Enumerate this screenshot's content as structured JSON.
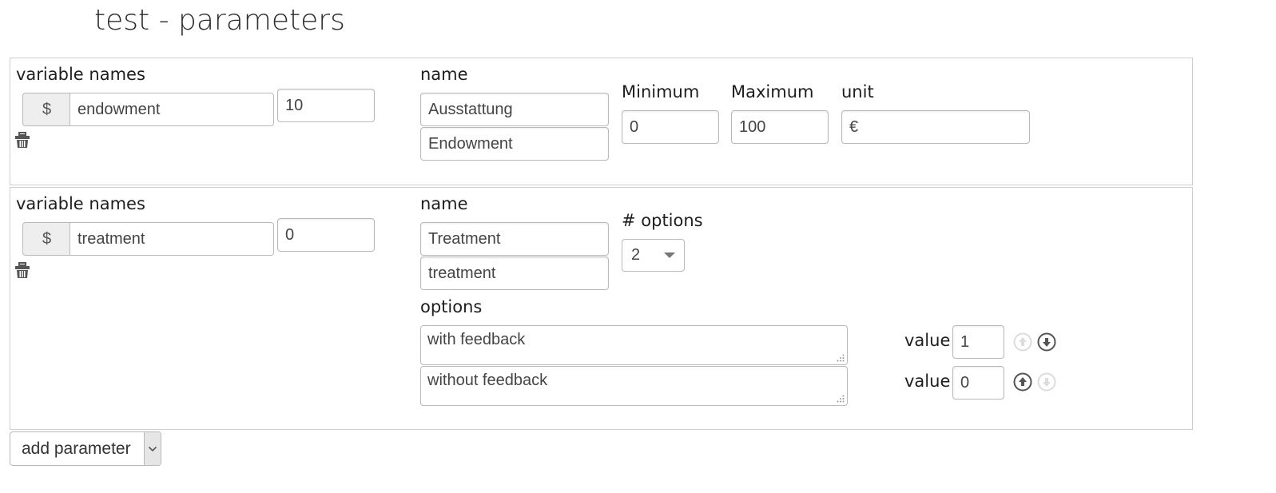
{
  "page": {
    "title": "test - parameters"
  },
  "parameters": [
    {
      "variable_names_label": "variable names",
      "prefix": "$",
      "variable": "endowment",
      "default_value": "10",
      "name_label": "name",
      "name_primary": "Ausstattung",
      "name_secondary": "Endowment",
      "minimum_label": "Minimum",
      "minimum": "0",
      "maximum_label": "Maximum",
      "maximum": "100",
      "unit_label": "unit",
      "unit": "€",
      "delete_icon": "trash-basket-icon"
    },
    {
      "variable_names_label": "variable names",
      "prefix": "$",
      "variable": "treatment",
      "default_value": "0",
      "name_label": "name",
      "name_primary": "Treatment",
      "name_secondary": "treatment",
      "num_options_label": "# options",
      "num_options": "2",
      "options_label": "options",
      "options": [
        {
          "text": "with feedback",
          "value_label": "value",
          "value": "1",
          "up_enabled": false,
          "down_enabled": true
        },
        {
          "text": "without feedback",
          "value_label": "value",
          "value": "0",
          "up_enabled": true,
          "down_enabled": false
        }
      ],
      "delete_icon": "trash-basket-icon"
    }
  ],
  "footer": {
    "add_parameter_label": "add parameter"
  },
  "colors": {
    "border": "#cfcfcf",
    "addon_bg": "#eeeeee",
    "icon": "#555555",
    "disabled_icon": "#d8d8d8"
  }
}
